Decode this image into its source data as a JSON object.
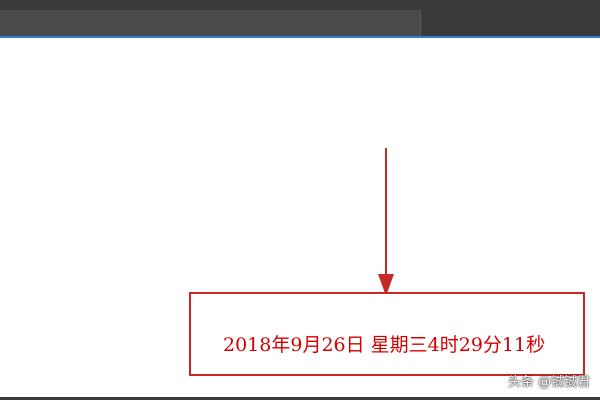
{
  "colors": {
    "toolbar": "#3a3a3a",
    "toolbar_inner": "#4a4a4a",
    "accent": "#2f7fcf",
    "highlight_red": "#c62828",
    "text_red": "#d40000"
  },
  "annotation": {
    "arrow_icon": "down-arrow-icon",
    "datetime_text": "2018年9月26日 星期三4时29分11秒"
  },
  "watermark": {
    "text": "头条 @铖铖君"
  }
}
